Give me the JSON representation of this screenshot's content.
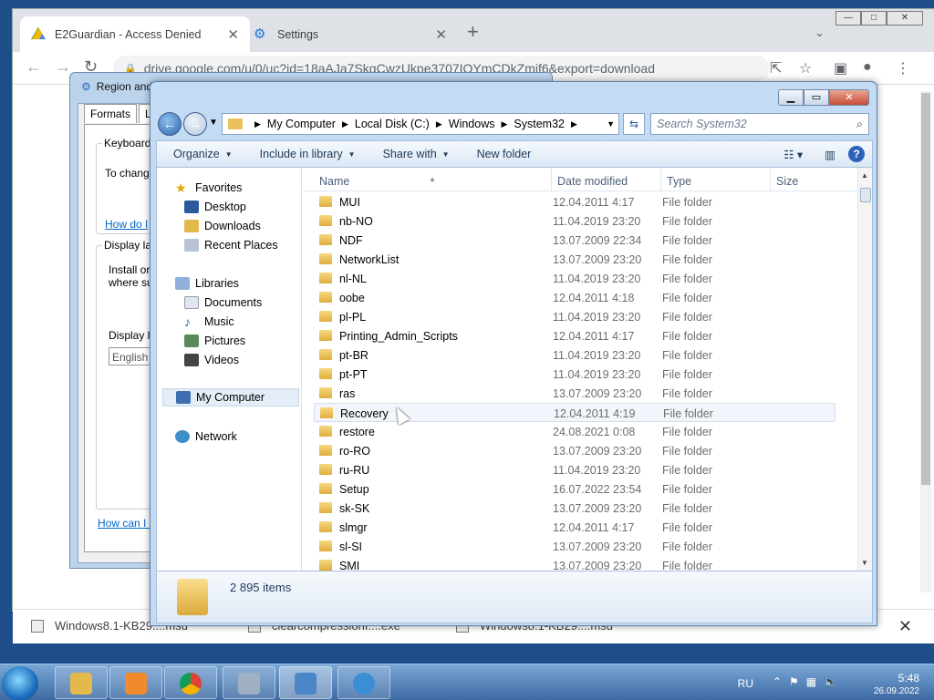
{
  "browser": {
    "tabs": [
      {
        "title": "E2Guardian - Access Denied",
        "icon": "google-drive-icon"
      },
      {
        "title": "Settings",
        "icon": "gear-icon"
      }
    ],
    "url": "drive.google.com/u/0/uc?id=18aAJa7SkqCwzUkpe3707IOYmCDkZmif6&export=download",
    "new_tab_label": "+",
    "downloads": [
      {
        "name": "Windows8.1-KB29....msu"
      },
      {
        "name": "clearcompressionf....exe"
      },
      {
        "name": "Windows8.1-KB29....msu"
      }
    ]
  },
  "region_window": {
    "title": "Region and",
    "tabs": [
      "Formats",
      "Loc"
    ],
    "keyboards_label": "Keyboards",
    "keyboards_text": "To chang",
    "link1": "How do I",
    "display_label": "Display la",
    "display_text1": "Install or",
    "display_text2": "where su",
    "display_lang_label": "Display l",
    "display_lang_value": "English",
    "link2": "How can I i"
  },
  "explorer": {
    "breadcrumb": [
      "My Computer",
      "Local Disk (C:)",
      "Windows",
      "System32"
    ],
    "search_placeholder": "Search System32",
    "commands": [
      "Organize",
      "Include in library",
      "Share with",
      "New folder"
    ],
    "nav": {
      "favorites": "Favorites",
      "desktop": "Desktop",
      "downloads": "Downloads",
      "recent": "Recent Places",
      "libraries": "Libraries",
      "documents": "Documents",
      "music": "Music",
      "pictures": "Pictures",
      "videos": "Videos",
      "computer": "My Computer",
      "network": "Network"
    },
    "columns": {
      "name": "Name",
      "date": "Date modified",
      "type": "Type",
      "size": "Size"
    },
    "rows": [
      {
        "name": "MUI",
        "date": "12.04.2011 4:17",
        "type": "File folder"
      },
      {
        "name": "nb-NO",
        "date": "11.04.2019 23:20",
        "type": "File folder"
      },
      {
        "name": "NDF",
        "date": "13.07.2009 22:34",
        "type": "File folder"
      },
      {
        "name": "NetworkList",
        "date": "13.07.2009 23:20",
        "type": "File folder"
      },
      {
        "name": "nl-NL",
        "date": "11.04.2019 23:20",
        "type": "File folder"
      },
      {
        "name": "oobe",
        "date": "12.04.2011 4:18",
        "type": "File folder"
      },
      {
        "name": "pl-PL",
        "date": "11.04.2019 23:20",
        "type": "File folder"
      },
      {
        "name": "Printing_Admin_Scripts",
        "date": "12.04.2011 4:17",
        "type": "File folder"
      },
      {
        "name": "pt-BR",
        "date": "11.04.2019 23:20",
        "type": "File folder"
      },
      {
        "name": "pt-PT",
        "date": "11.04.2019 23:20",
        "type": "File folder"
      },
      {
        "name": "ras",
        "date": "13.07.2009 23:20",
        "type": "File folder"
      },
      {
        "name": "Recovery",
        "date": "12.04.2011 4:19",
        "type": "File folder"
      },
      {
        "name": "restore",
        "date": "24.08.2021 0:08",
        "type": "File folder"
      },
      {
        "name": "ro-RO",
        "date": "13.07.2009 23:20",
        "type": "File folder"
      },
      {
        "name": "ru-RU",
        "date": "11.04.2019 23:20",
        "type": "File folder"
      },
      {
        "name": "Setup",
        "date": "16.07.2022 23:54",
        "type": "File folder"
      },
      {
        "name": "sk-SK",
        "date": "13.07.2009 23:20",
        "type": "File folder"
      },
      {
        "name": "slmgr",
        "date": "12.04.2011 4:17",
        "type": "File folder"
      },
      {
        "name": "sl-SI",
        "date": "13.07.2009 23:20",
        "type": "File folder"
      },
      {
        "name": "SMI",
        "date": "13.07.2009 23:20",
        "type": "File folder"
      }
    ],
    "item_count": "2 895 items"
  },
  "taskbar": {
    "lang": "RU",
    "time": "5:48",
    "date": "26.09.2022"
  }
}
